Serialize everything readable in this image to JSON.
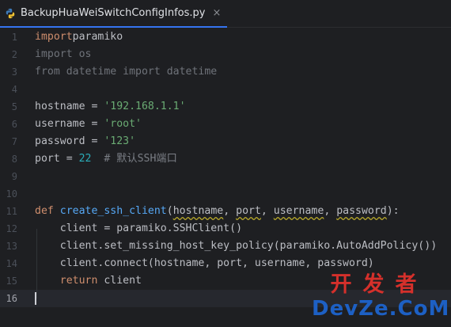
{
  "tab": {
    "filename": "BackupHuaWeiSwitchConfigInfos.py",
    "close": "×"
  },
  "lines": [
    {
      "n": "1",
      "tokens": [
        [
          "kw",
          "import"
        ],
        [
          "",
          "paramiko"
        ]
      ]
    },
    {
      "n": "2",
      "tokens": [
        [
          "unused",
          "import os"
        ]
      ]
    },
    {
      "n": "3",
      "tokens": [
        [
          "unused",
          "from datetime import datetime"
        ]
      ]
    },
    {
      "n": "4",
      "tokens": []
    },
    {
      "n": "5",
      "tokens": [
        [
          "",
          "hostname = "
        ],
        [
          "str",
          "'192.168.1.1'"
        ]
      ]
    },
    {
      "n": "6",
      "tokens": [
        [
          "",
          "username = "
        ],
        [
          "str",
          "'root'"
        ]
      ]
    },
    {
      "n": "7",
      "tokens": [
        [
          "",
          "password = "
        ],
        [
          "str",
          "'123'"
        ]
      ]
    },
    {
      "n": "8",
      "tokens": [
        [
          "",
          "port = "
        ],
        [
          "num",
          "22"
        ],
        [
          "",
          "  "
        ],
        [
          "cmt",
          "# 默认SSH端口"
        ]
      ]
    },
    {
      "n": "9",
      "tokens": []
    },
    {
      "n": "10",
      "tokens": []
    },
    {
      "n": "11",
      "tokens": [
        [
          "kw",
          "def "
        ],
        [
          "fn",
          "create_ssh_client"
        ],
        [
          "",
          "("
        ],
        [
          "param",
          "hostname"
        ],
        [
          "",
          ", "
        ],
        [
          "param",
          "port"
        ],
        [
          "",
          ", "
        ],
        [
          "param",
          "username"
        ],
        [
          "",
          ", "
        ],
        [
          "param",
          "password"
        ],
        [
          "",
          "):"
        ]
      ]
    },
    {
      "n": "12",
      "tokens": [
        [
          "",
          "    client = paramiko.SSHClient()"
        ]
      ]
    },
    {
      "n": "13",
      "tokens": [
        [
          "",
          "    client.set_missing_host_key_policy(paramiko.AutoAddPolicy())"
        ]
      ]
    },
    {
      "n": "14",
      "tokens": [
        [
          "",
          "    client.connect(hostname, port, username, password)"
        ]
      ]
    },
    {
      "n": "15",
      "tokens": [
        [
          "kw",
          "    return"
        ],
        [
          "",
          " client"
        ]
      ]
    },
    {
      "n": "16",
      "tokens": []
    }
  ],
  "current_line": "16",
  "watermark": {
    "top": "开发者",
    "bottom": "DevZe.CoM"
  },
  "colors": {
    "background": "#1e1f22",
    "keyword": "#cf8e6d",
    "string": "#6aab73",
    "number": "#2aacb8",
    "function": "#56a8f5",
    "comment": "#7a7e85",
    "tab_underline": "#3574f0"
  },
  "icons": {
    "file_type": "python-file-icon"
  }
}
